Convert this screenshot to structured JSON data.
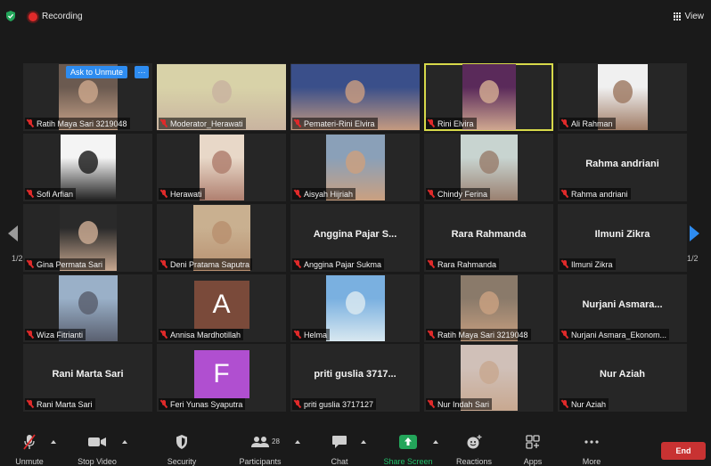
{
  "topbar": {
    "recording_label": "Recording",
    "view_label": "View"
  },
  "ask_button": "Ask to Unmute",
  "more_button": "···",
  "pages": {
    "left": "1/2",
    "right": "1/2"
  },
  "tiles": [
    {
      "label": "Ratih Maya Sari 3219048",
      "namecard": "",
      "letter": "",
      "type": "photo"
    },
    {
      "label": "Moderator_Herawati",
      "namecard": "",
      "letter": "",
      "type": "photo"
    },
    {
      "label": "Pemateri-Rini Elvira",
      "namecard": "",
      "letter": "",
      "type": "photo"
    },
    {
      "label": "Rini Elvira",
      "namecard": "",
      "letter": "",
      "type": "photo"
    },
    {
      "label": "Ali Rahman",
      "namecard": "",
      "letter": "",
      "type": "photo"
    },
    {
      "label": "Sofi Arfian",
      "namecard": "",
      "letter": "",
      "type": "photo"
    },
    {
      "label": "Herawati",
      "namecard": "",
      "letter": "",
      "type": "photo"
    },
    {
      "label": "Aisyah Hijriah",
      "namecard": "",
      "letter": "",
      "type": "photo"
    },
    {
      "label": "Chindy Ferina",
      "namecard": "",
      "letter": "",
      "type": "photo"
    },
    {
      "label": "Rahma andriani",
      "namecard": "Rahma andriani",
      "letter": "",
      "type": "name"
    },
    {
      "label": "Gina Permata Sari",
      "namecard": "",
      "letter": "",
      "type": "photo"
    },
    {
      "label": "Deni Pratama Saputra",
      "namecard": "",
      "letter": "",
      "type": "photo"
    },
    {
      "label": "Anggina Pajar Sukma",
      "namecard": "Anggina Pajar S...",
      "letter": "",
      "type": "name"
    },
    {
      "label": "Rara Rahmanda",
      "namecard": "Rara Rahmanda",
      "letter": "",
      "type": "name"
    },
    {
      "label": "Ilmuni Zikra",
      "namecard": "Ilmuni Zikra",
      "letter": "",
      "type": "name"
    },
    {
      "label": "Wiza Fitrianti",
      "namecard": "",
      "letter": "",
      "type": "photo"
    },
    {
      "label": "Annisa Mardhotillah",
      "namecard": "",
      "letter": "A",
      "type": "letter"
    },
    {
      "label": "Helma",
      "namecard": "",
      "letter": "",
      "type": "photo"
    },
    {
      "label": "Ratih Maya Sari 3219048",
      "namecard": "",
      "letter": "",
      "type": "photo"
    },
    {
      "label": "Nurjani Asmara_Ekonom...",
      "namecard": "Nurjani Asmara...",
      "letter": "",
      "type": "name"
    },
    {
      "label": "Rani Marta Sari",
      "namecard": "Rani Marta Sari",
      "letter": "",
      "type": "name"
    },
    {
      "label": "Feri Yunas Syaputra",
      "namecard": "",
      "letter": "F",
      "type": "letter"
    },
    {
      "label": "priti guslia 3717127",
      "namecard": "priti guslia 3717...",
      "letter": "",
      "type": "name"
    },
    {
      "label": "Nur Indah Sari",
      "namecard": "",
      "letter": "",
      "type": "photo"
    },
    {
      "label": "Nur Aziah",
      "namecard": "Nur Aziah",
      "letter": "",
      "type": "name"
    }
  ],
  "toolbar": {
    "unmute": "Unmute",
    "stop_video": "Stop Video",
    "security": "Security",
    "participants": "Participants",
    "participants_count": "28",
    "chat": "Chat",
    "share_screen": "Share Screen",
    "reactions": "Reactions",
    "apps": "Apps",
    "more": "More",
    "end": "End"
  },
  "colors": {
    "accent_blue": "#2e8cf0",
    "active_speaker": "#d7d94a",
    "share_green": "#23a55a",
    "end_red": "#c83232",
    "letter_brown": "#7a4a3a",
    "letter_purple": "#b04fd0"
  }
}
